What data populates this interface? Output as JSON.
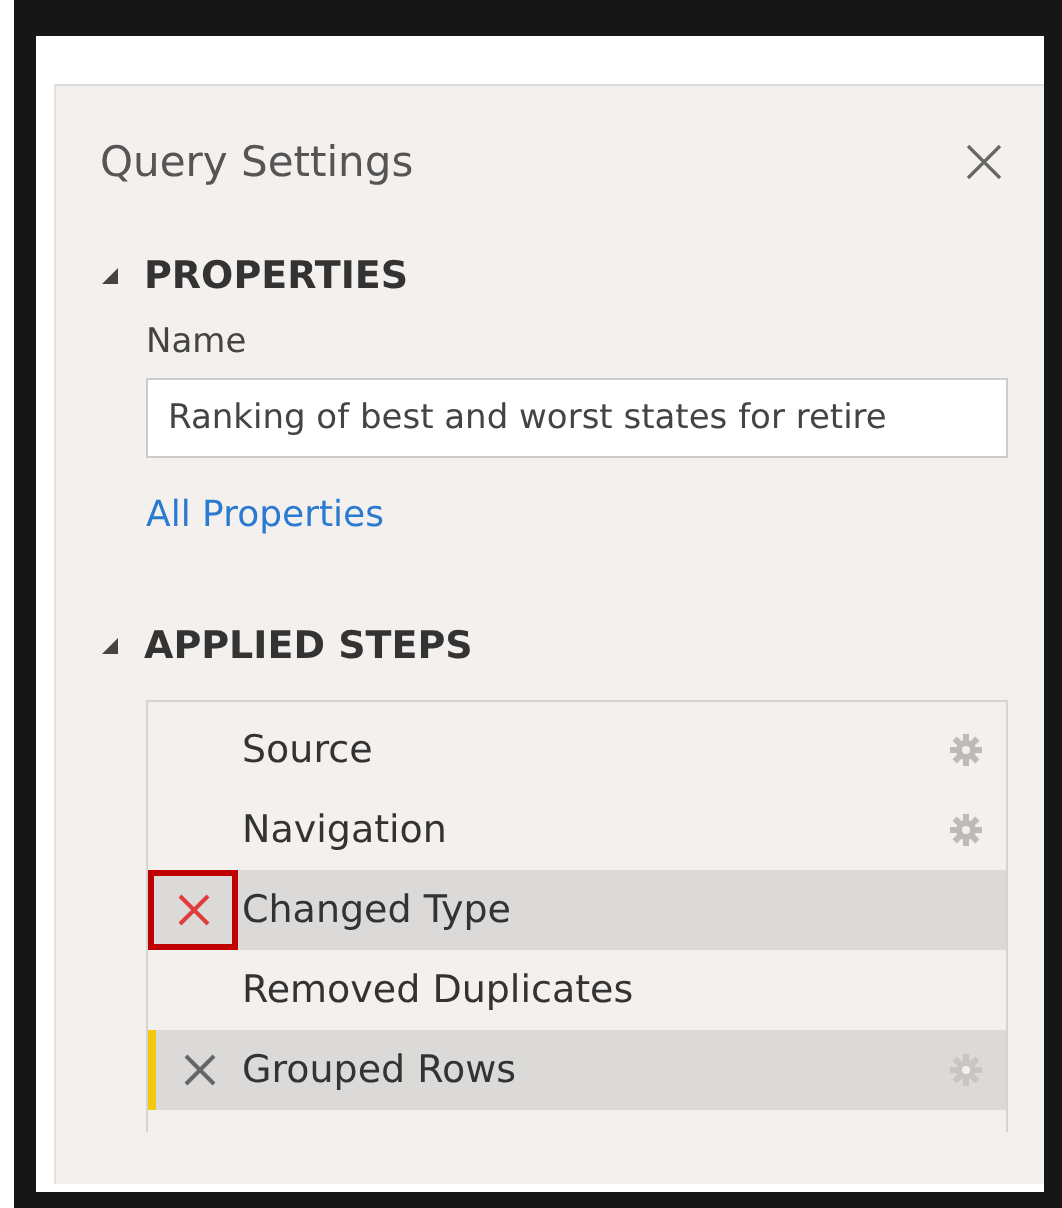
{
  "panel": {
    "title": "Query Settings"
  },
  "properties": {
    "heading": "PROPERTIES",
    "expanded": true,
    "name_label": "Name",
    "name_value": "Ranking of best and worst states for retire",
    "link": "All Properties"
  },
  "applied_steps": {
    "heading": "APPLIED STEPS",
    "expanded": true,
    "steps": [
      {
        "label": "Source",
        "selected": false,
        "hovered": false,
        "settings": true,
        "annotated": false
      },
      {
        "label": "Navigation",
        "selected": false,
        "hovered": false,
        "settings": true,
        "annotated": false
      },
      {
        "label": "Changed Type",
        "selected": false,
        "hovered": true,
        "settings": false,
        "annotated": true
      },
      {
        "label": "Removed Duplicates",
        "selected": false,
        "hovered": false,
        "settings": false,
        "annotated": false
      },
      {
        "label": "Grouped Rows",
        "selected": true,
        "hovered": false,
        "settings": true,
        "annotated": false
      }
    ]
  }
}
